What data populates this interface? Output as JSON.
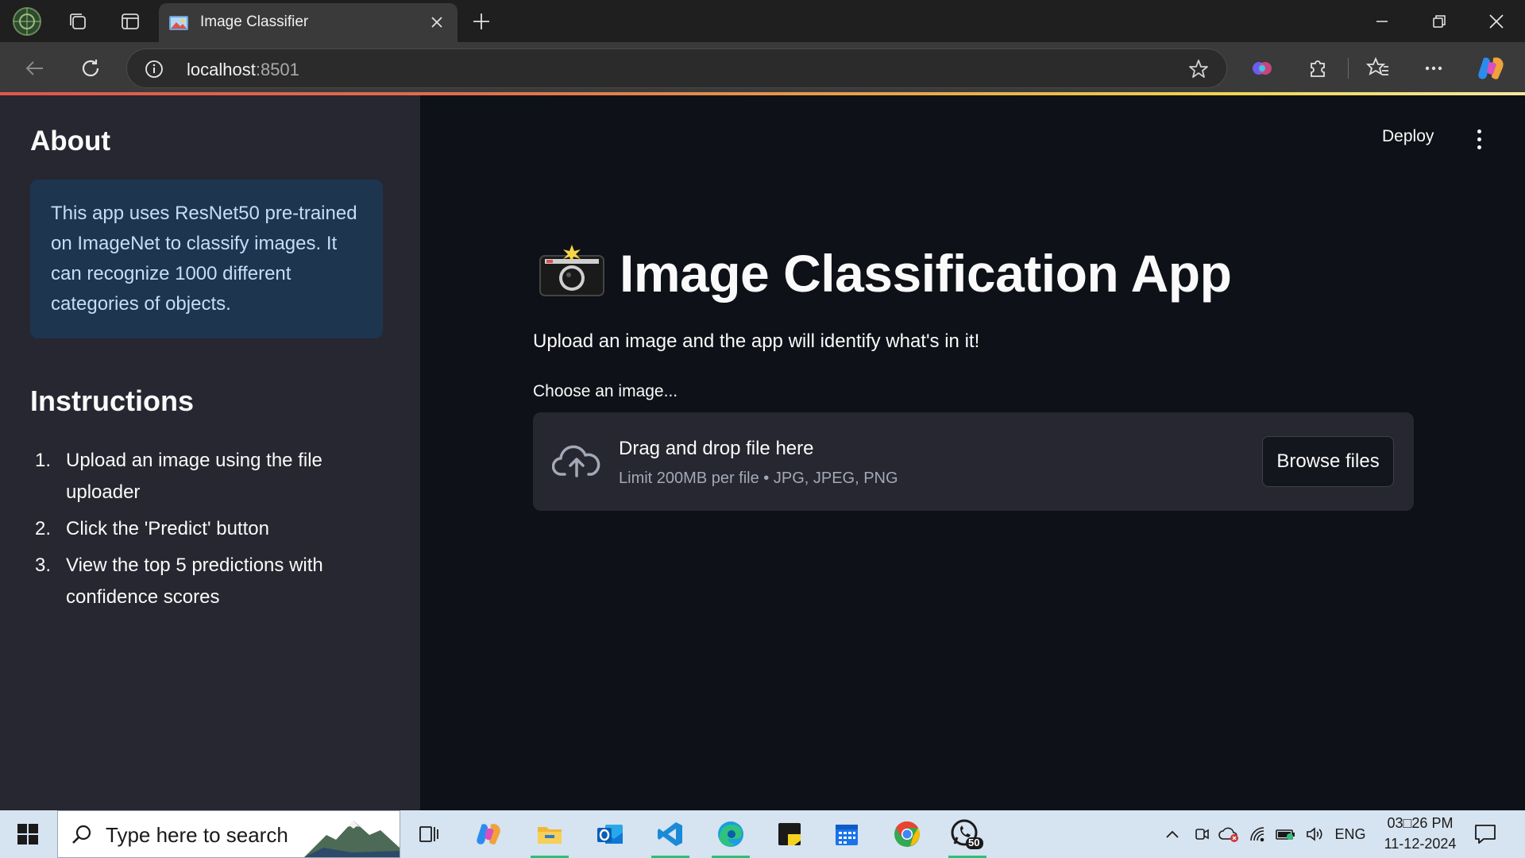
{
  "browser": {
    "tab": {
      "title": "Image Classifier",
      "favicon": "image-favicon-icon"
    },
    "address": {
      "host": "localhost",
      "port": ":8501"
    },
    "icons": [
      "profile-icon",
      "collections-icon",
      "tab-actions-icon",
      "new-tab-icon",
      "back-icon",
      "refresh-icon",
      "info-icon",
      "favorite-star-icon",
      "copilot-extension-icon",
      "extensions-icon",
      "favorites-icon",
      "more-icon",
      "copilot-icon",
      "minimize-icon",
      "restore-icon",
      "close-icon"
    ],
    "accent_gradient": [
      "#e0574e",
      "#e9a74a",
      "#f0d44f"
    ]
  },
  "sidebar": {
    "about_heading": "About",
    "about_text": "This app uses ResNet50 pre-trained on ImageNet to classify images. It can recognize 1000 different categories of objects.",
    "instructions_heading": "Instructions",
    "instructions": [
      {
        "num": "1.",
        "text": "Upload an image using the file uploader"
      },
      {
        "num": "2.",
        "text": "Click the 'Predict' button"
      },
      {
        "num": "3.",
        "text": "View the top 5 predictions with confidence scores"
      }
    ],
    "colors": {
      "bg": "#262730",
      "info_bg": "#1e3550",
      "info_text": "#c7ddf7"
    }
  },
  "header": {
    "deploy_label": "Deploy",
    "menu_icon": "kebab-menu-icon"
  },
  "main": {
    "title_emoji_icon": "camera-flash-icon",
    "title": "Image Classification App",
    "subtitle": "Upload an image and the app will identify what's in it!",
    "uploader": {
      "label": "Choose an image...",
      "drop_text": "Drag and drop file here",
      "limit_text": "Limit 200MB per file • JPG, JPEG, PNG",
      "browse_label": "Browse files",
      "icon": "cloud-upload-icon"
    },
    "colors": {
      "bg": "#0e1117",
      "text": "#fafafa",
      "dropzone_bg": "#262730"
    }
  },
  "taskbar": {
    "search_placeholder": "Type here to search",
    "apps": [
      "task-view-icon",
      "copilot-app-icon",
      "file-explorer-icon",
      "outlook-icon",
      "vscode-icon",
      "edge-icon",
      "sticky-notes-icon",
      "calendar-icon",
      "chrome-icon",
      "whatsapp-icon"
    ],
    "whatsapp_badge": "50",
    "language": "ENG",
    "time": "03□26 PM",
    "date": "11-12-2024"
  }
}
